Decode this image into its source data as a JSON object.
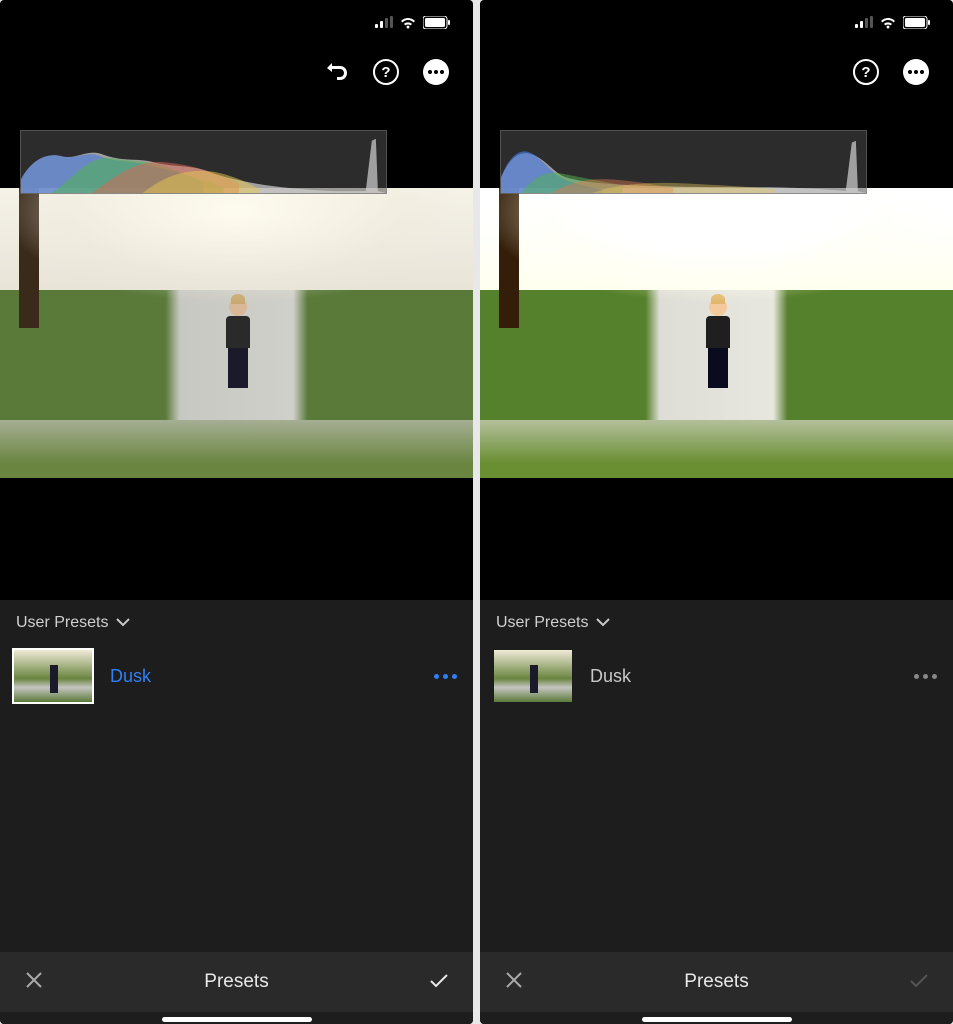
{
  "left": {
    "toolbar": {
      "has_undo": true
    },
    "presets": {
      "group_label": "User Presets",
      "items": [
        {
          "name": "Dusk",
          "selected": true
        }
      ]
    },
    "bottom": {
      "title": "Presets",
      "confirm_enabled": true
    }
  },
  "right": {
    "toolbar": {
      "has_undo": false
    },
    "presets": {
      "group_label": "User Presets",
      "items": [
        {
          "name": "Dusk",
          "selected": false
        }
      ]
    },
    "bottom": {
      "title": "Presets",
      "confirm_enabled": false
    }
  }
}
